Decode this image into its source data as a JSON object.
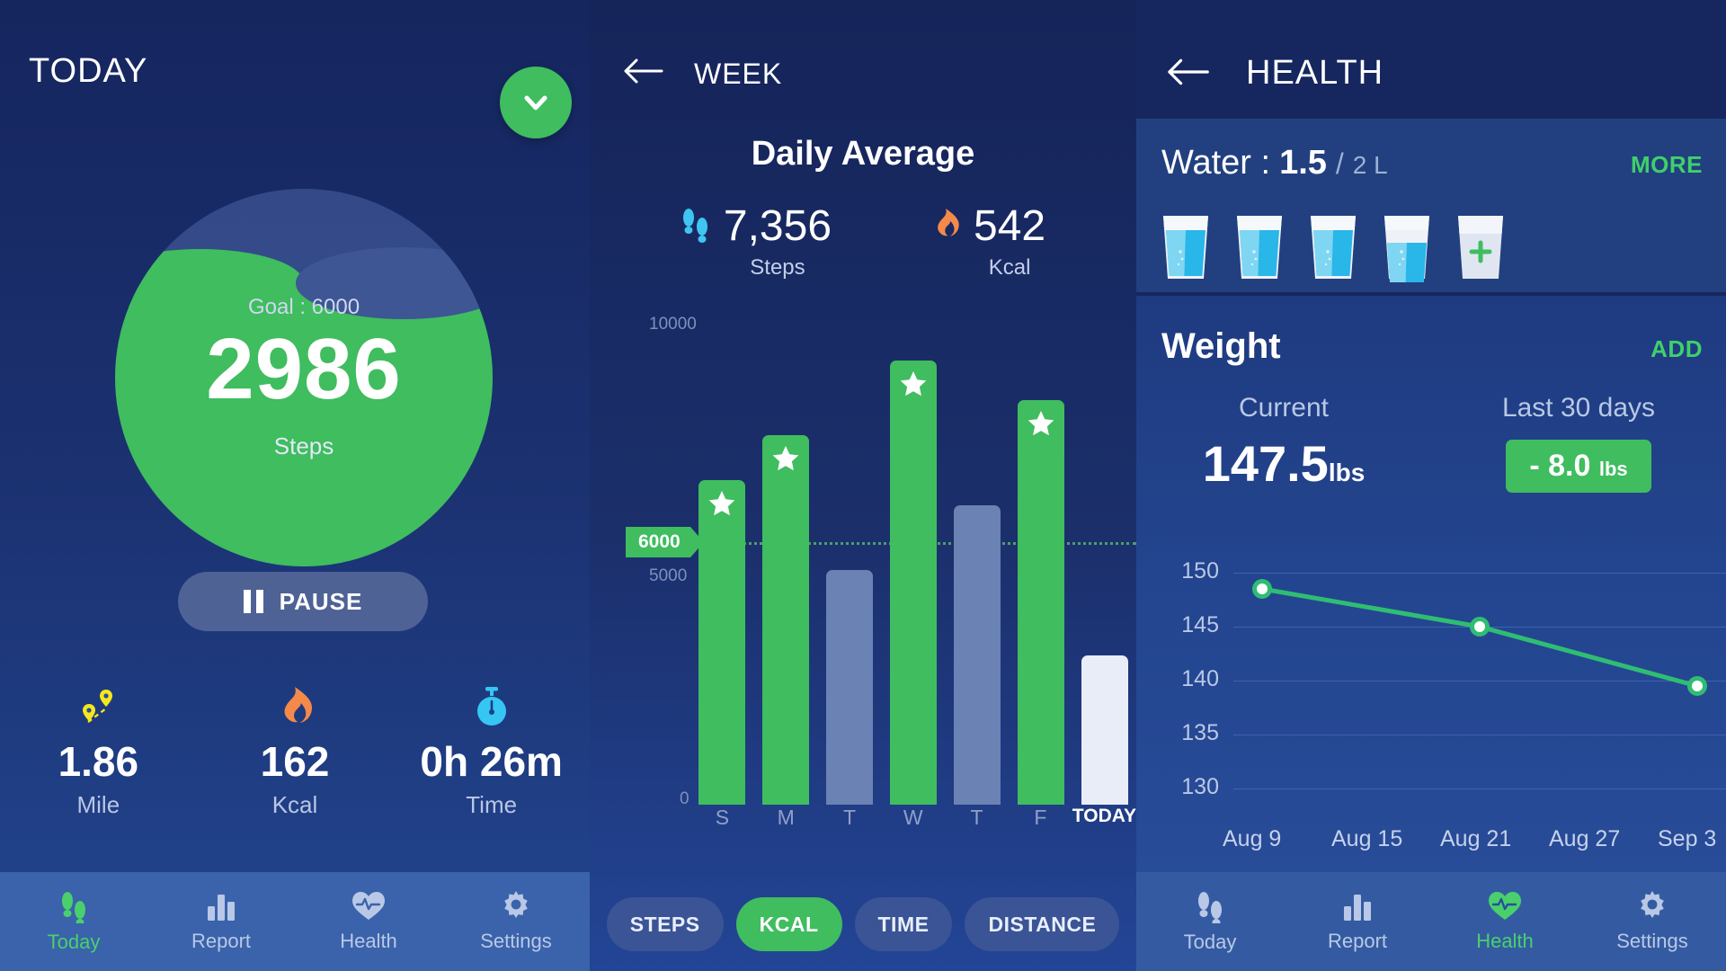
{
  "today": {
    "title": "TODAY",
    "goal_text": "Goal : 6000",
    "steps_value": "2986",
    "steps_label": "Steps",
    "pause_label": "PAUSE",
    "stats": [
      {
        "icon": "route-pin-icon",
        "value": "1.86",
        "label": "Mile"
      },
      {
        "icon": "flame-icon",
        "value": "162",
        "label": "Kcal"
      },
      {
        "icon": "stopwatch-icon",
        "value": "0h 26m",
        "label": "Time"
      }
    ],
    "nav": [
      {
        "icon": "footsteps-icon",
        "label": "Today",
        "active": true
      },
      {
        "icon": "bar-chart-icon",
        "label": "Report",
        "active": false
      },
      {
        "icon": "heart-pulse-icon",
        "label": "Health",
        "active": false
      },
      {
        "icon": "gear-icon",
        "label": "Settings",
        "active": false
      }
    ]
  },
  "week": {
    "title": "WEEK",
    "section_title": "Daily Average",
    "averages": [
      {
        "icon": "footsteps-icon",
        "value": "7,356",
        "label": "Steps"
      },
      {
        "icon": "flame-icon",
        "value": "542",
        "label": "Kcal"
      }
    ],
    "filters": [
      {
        "label": "STEPS",
        "active": false
      },
      {
        "label": "KCAL",
        "active": true
      },
      {
        "label": "TIME",
        "active": false
      },
      {
        "label": "DISTANCE",
        "active": false
      }
    ]
  },
  "health": {
    "title": "HEALTH",
    "water": {
      "label": "Water :",
      "value": "1.5",
      "separator": "/",
      "goal": "2 L",
      "more_label": "MORE",
      "glasses": [
        {
          "state": "full"
        },
        {
          "state": "full"
        },
        {
          "state": "full"
        },
        {
          "state": "half"
        },
        {
          "state": "add"
        }
      ]
    },
    "weight": {
      "title": "Weight",
      "add_label": "ADD",
      "current_label": "Current",
      "current_value": "147.5",
      "current_unit": "lbs",
      "range_label": "Last 30 days",
      "delta_value": "- 8.0",
      "delta_unit": "lbs"
    }
  },
  "chart_data": [
    {
      "type": "bar",
      "title": "Weekly Steps",
      "categories": [
        "S",
        "M",
        "T",
        "W",
        "T",
        "F",
        "TODAY"
      ],
      "values": [
        6500,
        7400,
        4700,
        8900,
        6000,
        8100,
        2986
      ],
      "goal": 6000,
      "goal_label": "6000",
      "bar_colors": [
        "green",
        "green",
        "grey",
        "green",
        "grey",
        "green",
        "today"
      ],
      "star_flags": [
        true,
        true,
        false,
        true,
        false,
        true,
        false
      ],
      "ytick_labels": [
        "10000",
        "5000",
        "0"
      ],
      "ylim": [
        0,
        10000
      ],
      "xlabel": "",
      "ylabel": "",
      "grid": false,
      "legend": "none"
    },
    {
      "type": "line",
      "title": "Weight last 30 days",
      "x": [
        "Aug 9",
        "Aug 15",
        "Aug 21",
        "Aug 27",
        "Sep 3"
      ],
      "points": [
        {
          "x": "Aug 9",
          "y": 148.5
        },
        {
          "x": "Aug 21",
          "y": 145.0
        },
        {
          "x": "Sep 3",
          "y": 139.5
        }
      ],
      "ytick_labels": [
        "150",
        "145",
        "140",
        "135",
        "130"
      ],
      "ylim": [
        130,
        150
      ],
      "xlabel": "",
      "ylabel": "lbs",
      "grid": true,
      "line_color": "#2fbd73",
      "legend": "none"
    }
  ],
  "colors": {
    "accent_green": "#3fbd5f",
    "bright_green": "#3fd06a",
    "dark_navy": "#16265f",
    "panel_blue": "#23458f",
    "grey_bar": "#6b82b4",
    "today_bar": "#e9edf7",
    "flame_orange": "#f4894a",
    "water_blue": "#29b6e8",
    "pin_yellow": "#f6e71d"
  }
}
